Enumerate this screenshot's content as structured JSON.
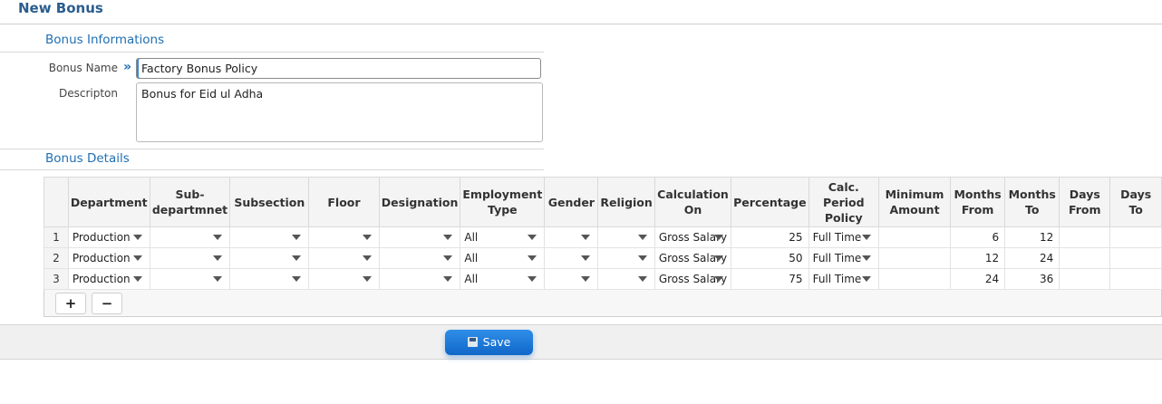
{
  "page": {
    "title": "New Bonus"
  },
  "bonus_info": {
    "section_title": "Bonus Informations",
    "name_label": "Bonus Name",
    "name_value": "Factory Bonus Policy",
    "description_label": "Descripton",
    "description_value": "Bonus for Eid ul Adha"
  },
  "bonus_details": {
    "section_title": "Bonus Details",
    "columns": [
      "Department",
      "Sub-\ndepartmnet",
      "Subsection",
      "Floor",
      "Designation",
      "Employment\nType",
      "Gender",
      "Religion",
      "Calculation\nOn",
      "Percentage",
      "Calc.\nPeriod\nPolicy",
      "Minimum\nAmount",
      "Months\nFrom",
      "Months\nTo",
      "Days\nFrom",
      "Days To"
    ],
    "rows": [
      {
        "no": "1",
        "department": "Production",
        "sub_department": "",
        "subsection": "",
        "floor": "",
        "designation": "",
        "employment_type": "All",
        "gender": "",
        "religion": "",
        "calculation_on": "Gross Salary",
        "percentage": "25",
        "period_policy": "Full Time",
        "minimum_amount": "",
        "months_from": "6",
        "months_to": "12",
        "days_from": "",
        "days_to": ""
      },
      {
        "no": "2",
        "department": "Production",
        "sub_department": "",
        "subsection": "",
        "floor": "",
        "designation": "",
        "employment_type": "All",
        "gender": "",
        "religion": "",
        "calculation_on": "Gross Salary",
        "percentage": "50",
        "period_policy": "Full Time",
        "minimum_amount": "",
        "months_from": "12",
        "months_to": "24",
        "days_from": "",
        "days_to": ""
      },
      {
        "no": "3",
        "department": "Production",
        "sub_department": "",
        "subsection": "",
        "floor": "",
        "designation": "",
        "employment_type": "All",
        "gender": "",
        "religion": "",
        "calculation_on": "Gross Salary",
        "percentage": "75",
        "period_policy": "Full Time",
        "minimum_amount": "",
        "months_from": "24",
        "months_to": "36",
        "days_from": "",
        "days_to": ""
      }
    ],
    "add_label": "+",
    "remove_label": "−"
  },
  "footer": {
    "save_label": "Save"
  },
  "icons": {
    "focus_marker": "double-chevron-right-icon",
    "dropdown": "caret-down-icon",
    "save": "floppy-disk-icon"
  },
  "colors": {
    "title": "#2b5d8f",
    "section": "#1f6fb3",
    "save_button": "#1a77d8"
  }
}
